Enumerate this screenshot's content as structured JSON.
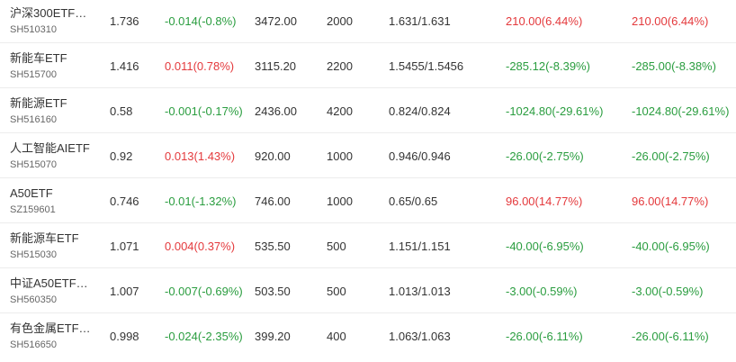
{
  "colors": {
    "up": "#e4393c",
    "down": "#2a9d3f",
    "text": "#333333",
    "code": "#666666",
    "divider": "#ececec"
  },
  "rows": [
    {
      "name": "沪深300ETF…",
      "code": "SH510310",
      "price": "1.736",
      "change": "-0.014(-0.8%)",
      "change_dir": "down",
      "market_value": "3472.00",
      "quantity": "2000",
      "cost": "1.631/1.631",
      "pnl": "210.00(6.44%)",
      "pnl_dir": "up",
      "pnl2": "210.00(6.44%)",
      "pnl2_dir": "up"
    },
    {
      "name": "新能车ETF",
      "code": "SH515700",
      "price": "1.416",
      "change": "0.011(0.78%)",
      "change_dir": "up",
      "market_value": "3115.20",
      "quantity": "2200",
      "cost": "1.5455/1.5456",
      "pnl": "-285.12(-8.39%)",
      "pnl_dir": "down",
      "pnl2": "-285.00(-8.38%)",
      "pnl2_dir": "down"
    },
    {
      "name": "新能源ETF",
      "code": "SH516160",
      "price": "0.58",
      "change": "-0.001(-0.17%)",
      "change_dir": "down",
      "market_value": "2436.00",
      "quantity": "4200",
      "cost": "0.824/0.824",
      "pnl": "-1024.80(-29.61%)",
      "pnl_dir": "down",
      "pnl2": "-1024.80(-29.61%)",
      "pnl2_dir": "down"
    },
    {
      "name": "人工智能AIETF",
      "code": "SH515070",
      "price": "0.92",
      "change": "0.013(1.43%)",
      "change_dir": "up",
      "market_value": "920.00",
      "quantity": "1000",
      "cost": "0.946/0.946",
      "pnl": "-26.00(-2.75%)",
      "pnl_dir": "down",
      "pnl2": "-26.00(-2.75%)",
      "pnl2_dir": "down"
    },
    {
      "name": "A50ETF",
      "code": "SZ159601",
      "price": "0.746",
      "change": "-0.01(-1.32%)",
      "change_dir": "down",
      "market_value": "746.00",
      "quantity": "1000",
      "cost": "0.65/0.65",
      "pnl": "96.00(14.77%)",
      "pnl_dir": "up",
      "pnl2": "96.00(14.77%)",
      "pnl2_dir": "up"
    },
    {
      "name": "新能源车ETF",
      "code": "SH515030",
      "price": "1.071",
      "change": "0.004(0.37%)",
      "change_dir": "up",
      "market_value": "535.50",
      "quantity": "500",
      "cost": "1.151/1.151",
      "pnl": "-40.00(-6.95%)",
      "pnl_dir": "down",
      "pnl2": "-40.00(-6.95%)",
      "pnl2_dir": "down"
    },
    {
      "name": "中证A50ETF…",
      "code": "SH560350",
      "price": "1.007",
      "change": "-0.007(-0.69%)",
      "change_dir": "down",
      "market_value": "503.50",
      "quantity": "500",
      "cost": "1.013/1.013",
      "pnl": "-3.00(-0.59%)",
      "pnl_dir": "down",
      "pnl2": "-3.00(-0.59%)",
      "pnl2_dir": "down"
    },
    {
      "name": "有色金属ETF…",
      "code": "SH516650",
      "price": "0.998",
      "change": "-0.024(-2.35%)",
      "change_dir": "down",
      "market_value": "399.20",
      "quantity": "400",
      "cost": "1.063/1.063",
      "pnl": "-26.00(-6.11%)",
      "pnl_dir": "down",
      "pnl2": "-26.00(-6.11%)",
      "pnl2_dir": "down"
    }
  ]
}
